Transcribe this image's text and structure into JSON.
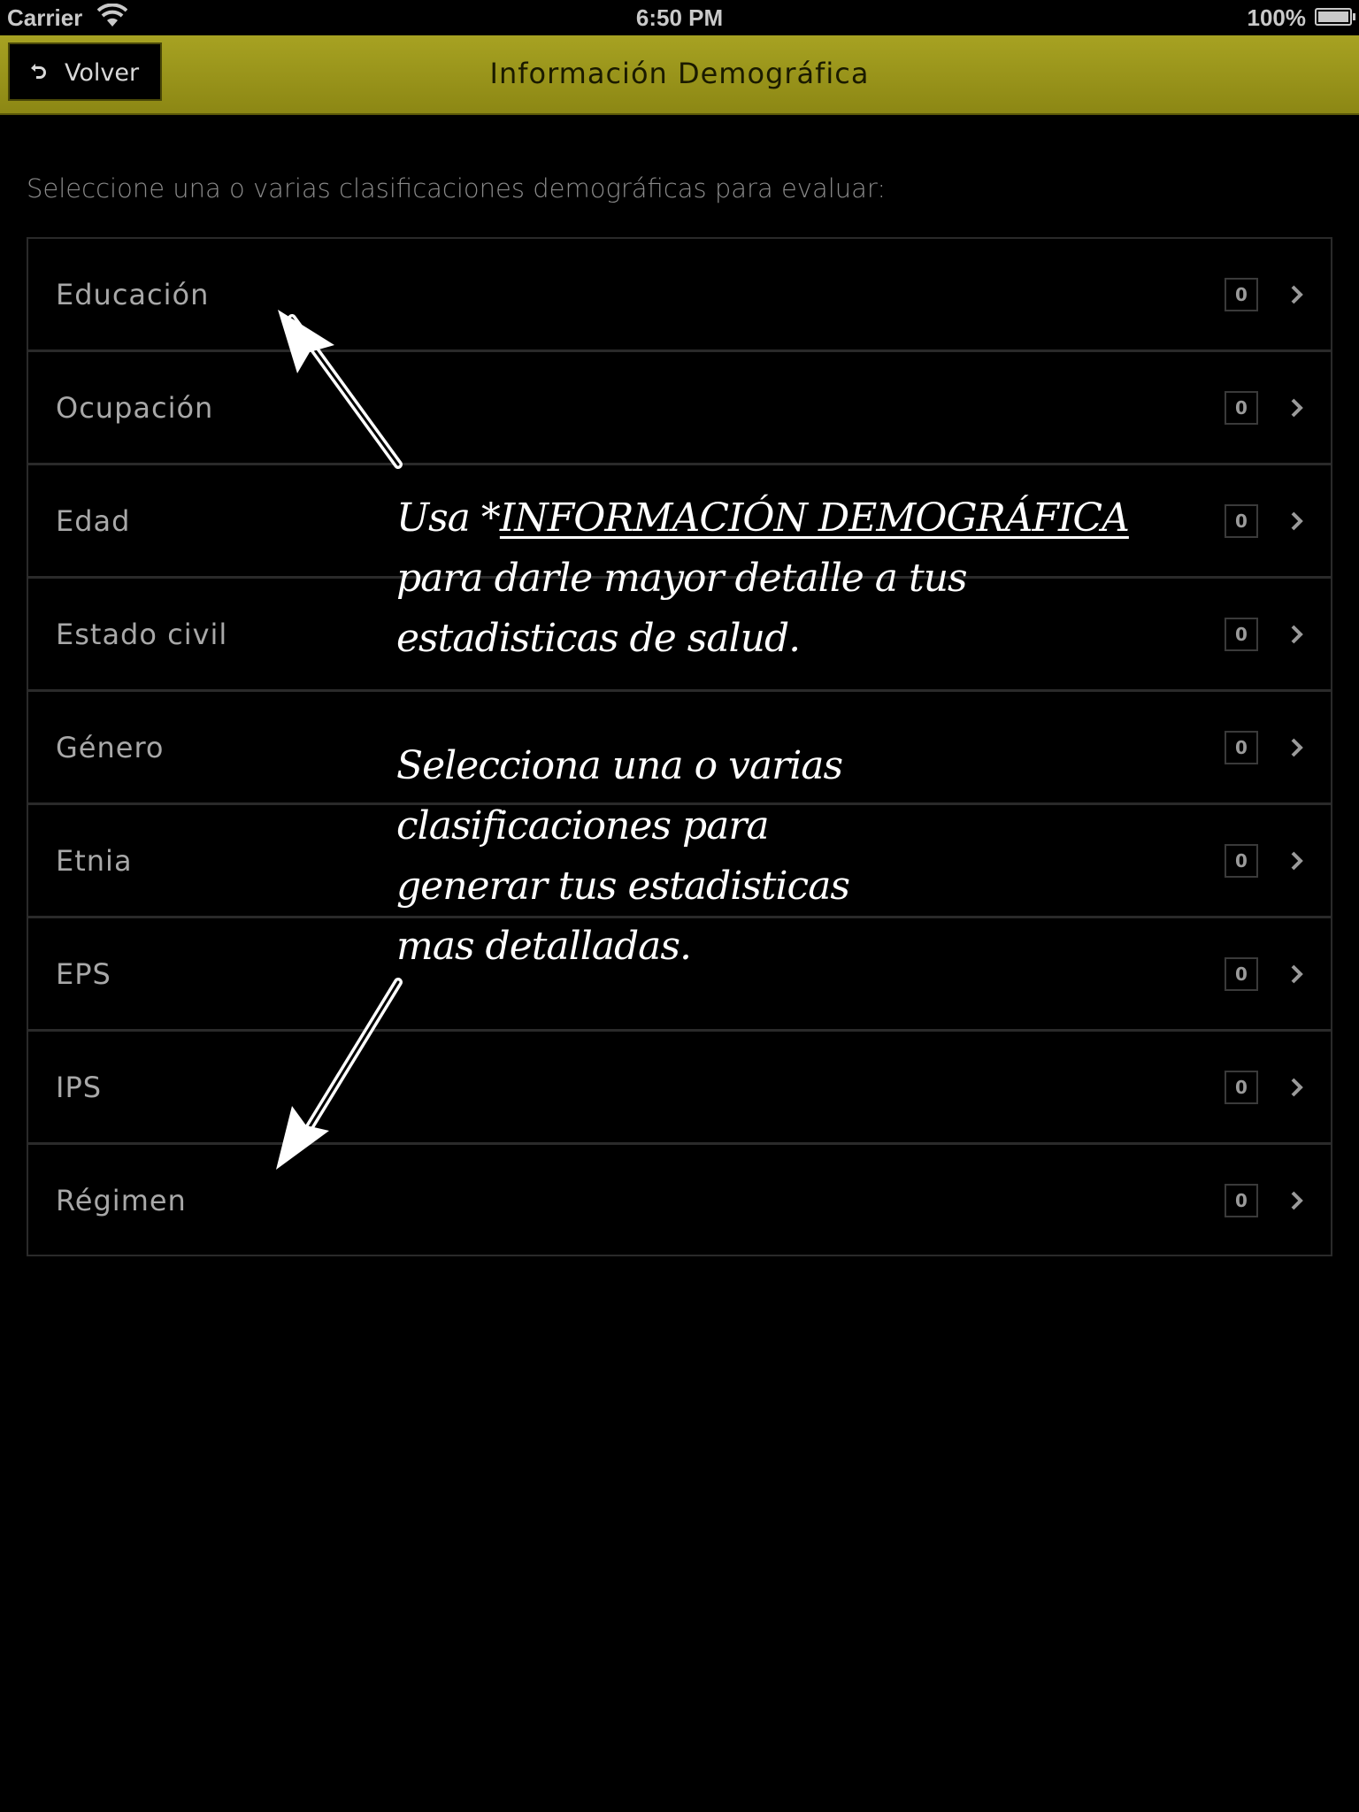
{
  "status_bar": {
    "carrier": "Carrier",
    "time": "6:50 PM",
    "battery": "100%"
  },
  "nav": {
    "back_label": "Volver",
    "title": "Información Demográfica"
  },
  "instruction": "Seleccione una o varias clasificaciones demográficas para evaluar:",
  "items": [
    {
      "label": "Educación",
      "count": "0"
    },
    {
      "label": "Ocupación",
      "count": "0"
    },
    {
      "label": "Edad",
      "count": "0"
    },
    {
      "label": "Estado civil",
      "count": "0"
    },
    {
      "label": "Género",
      "count": "0"
    },
    {
      "label": "Etnia",
      "count": "0"
    },
    {
      "label": "EPS",
      "count": "0"
    },
    {
      "label": "IPS",
      "count": "0"
    },
    {
      "label": "Régimen",
      "count": "0"
    }
  ],
  "annotation_1": {
    "prefix": "Usa *",
    "highlight": "INFORMACIÓN DEMOGRÁFICA",
    "line_2": "para darle mayor detalle a tus",
    "line_3": "estadisticas de salud."
  },
  "annotation_2": {
    "line_1": "Selecciona una o varias",
    "line_2": "clasificaciones para",
    "line_3": "generar tus estadisticas",
    "line_4": "mas detalladas."
  },
  "colors": {
    "nav_bar": "#9a9519",
    "background": "#000000",
    "item_text": "#a8a8a8",
    "annotation": "#ffffff"
  }
}
